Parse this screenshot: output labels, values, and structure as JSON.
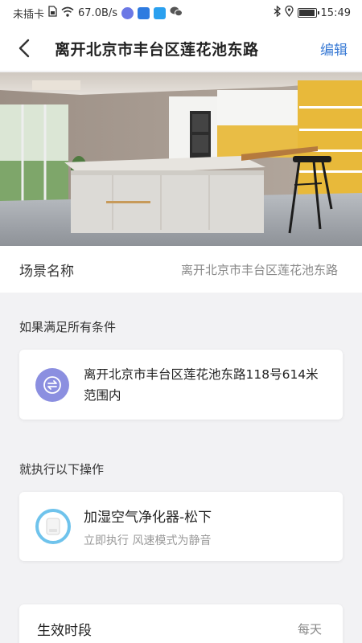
{
  "status_bar": {
    "carrier": "未插卡",
    "speed": "67.0B/s",
    "time": "15:49",
    "battery_level": 0.95,
    "app_icons": [
      "music-icon",
      "bulb-icon",
      "search-app-icon",
      "wechat-icon"
    ]
  },
  "header": {
    "title": "离开北京市丰台区莲花池东路",
    "edit_label": "编辑"
  },
  "scene": {
    "label": "场景名称",
    "value": "离开北京市丰台区莲花池东路"
  },
  "condition": {
    "section_title": "如果满足所有条件",
    "text": "离开北京市丰台区莲花池东路118号614米范围内",
    "icon": "swap-icon",
    "icon_color": "#8b8fe0"
  },
  "action": {
    "section_title": "就执行以下操作",
    "device_name": "加湿空气净化器-松下",
    "description": "立即执行 风速模式为静音",
    "icon": "air-purifier-icon",
    "icon_ring_color": "#6fc3ec"
  },
  "schedule": {
    "label": "生效时段",
    "value": "每天"
  },
  "colors": {
    "accent": "#3a7bd5",
    "background": "#f2f2f4"
  }
}
